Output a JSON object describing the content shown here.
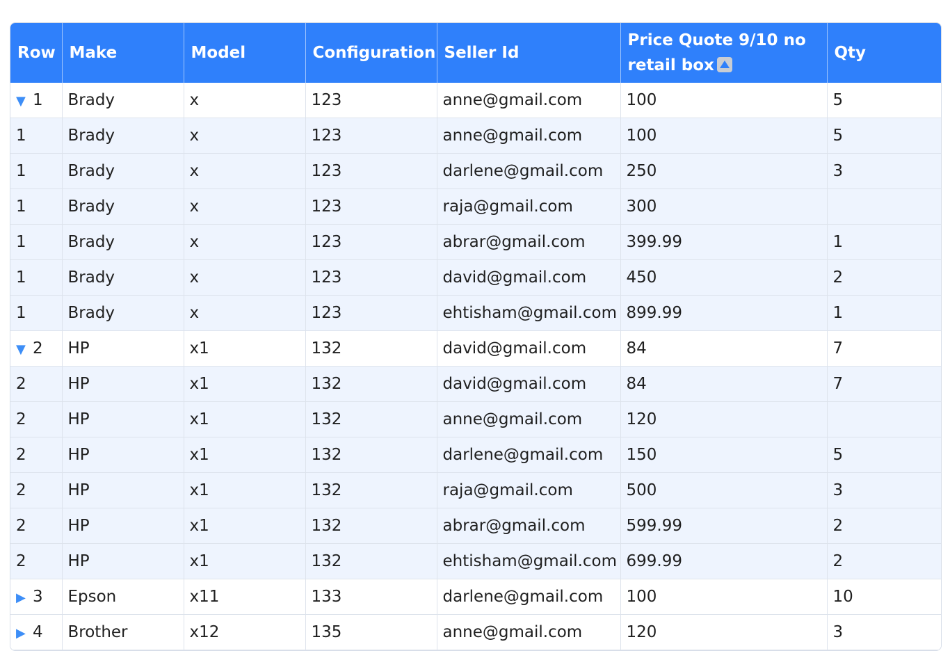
{
  "columns": [
    "Row",
    "Make",
    "Model",
    "Configuration",
    "Seller Id",
    "Price Quote 9/10 no retail box",
    "Qty"
  ],
  "colors": {
    "header_bg": "#2f80fb",
    "child_row_bg": "#eef4fe",
    "toggle": "#3d8ef7"
  },
  "sorted_column": "Price Quote 9/10 no retail box",
  "sort_direction": "ascending",
  "rows": [
    {
      "type": "group",
      "expanded": true,
      "row": "1",
      "make": "Brady",
      "model": "x",
      "config": "123",
      "seller": "anne@gmail.com",
      "price": "100",
      "qty": "5"
    },
    {
      "type": "child",
      "row": "1",
      "make": "Brady",
      "model": "x",
      "config": "123",
      "seller": "anne@gmail.com",
      "price": "100",
      "qty": "5"
    },
    {
      "type": "child",
      "row": "1",
      "make": "Brady",
      "model": "x",
      "config": "123",
      "seller": "darlene@gmail.com",
      "price": "250",
      "qty": "3"
    },
    {
      "type": "child",
      "row": "1",
      "make": "Brady",
      "model": "x",
      "config": "123",
      "seller": "raja@gmail.com",
      "price": "300",
      "qty": ""
    },
    {
      "type": "child",
      "row": "1",
      "make": "Brady",
      "model": "x",
      "config": "123",
      "seller": "abrar@gmail.com",
      "price": "399.99",
      "qty": "1"
    },
    {
      "type": "child",
      "row": "1",
      "make": "Brady",
      "model": "x",
      "config": "123",
      "seller": "david@gmail.com",
      "price": "450",
      "qty": "2"
    },
    {
      "type": "child",
      "row": "1",
      "make": "Brady",
      "model": "x",
      "config": "123",
      "seller": "ehtisham@gmail.com",
      "price": "899.99",
      "qty": "1"
    },
    {
      "type": "group",
      "expanded": true,
      "row": "2",
      "make": "HP",
      "model": "x1",
      "config": "132",
      "seller": "david@gmail.com",
      "price": "84",
      "qty": "7"
    },
    {
      "type": "child",
      "row": "2",
      "make": "HP",
      "model": "x1",
      "config": "132",
      "seller": "david@gmail.com",
      "price": "84",
      "qty": "7"
    },
    {
      "type": "child",
      "row": "2",
      "make": "HP",
      "model": "x1",
      "config": "132",
      "seller": "anne@gmail.com",
      "price": "120",
      "qty": ""
    },
    {
      "type": "child",
      "row": "2",
      "make": "HP",
      "model": "x1",
      "config": "132",
      "seller": "darlene@gmail.com",
      "price": "150",
      "qty": "5"
    },
    {
      "type": "child",
      "row": "2",
      "make": "HP",
      "model": "x1",
      "config": "132",
      "seller": "raja@gmail.com",
      "price": "500",
      "qty": "3"
    },
    {
      "type": "child",
      "row": "2",
      "make": "HP",
      "model": "x1",
      "config": "132",
      "seller": "abrar@gmail.com",
      "price": "599.99",
      "qty": "2"
    },
    {
      "type": "child",
      "row": "2",
      "make": "HP",
      "model": "x1",
      "config": "132",
      "seller": "ehtisham@gmail.com",
      "price": "699.99",
      "qty": "2"
    },
    {
      "type": "group",
      "expanded": false,
      "row": "3",
      "make": "Epson",
      "model": "x11",
      "config": "133",
      "seller": "darlene@gmail.com",
      "price": "100",
      "qty": "10"
    },
    {
      "type": "group",
      "expanded": false,
      "row": "4",
      "make": "Brother",
      "model": "x12",
      "config": "135",
      "seller": "anne@gmail.com",
      "price": "120",
      "qty": "3"
    }
  ]
}
